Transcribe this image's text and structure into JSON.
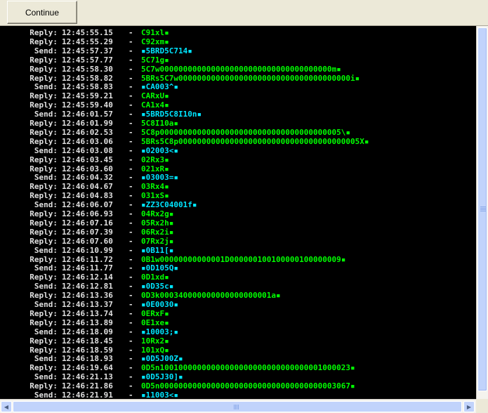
{
  "toolbar": {
    "continue_label": "Continue"
  },
  "colors": {
    "send": "#00e5ff",
    "reply": "#00ff00",
    "text": "#e0e0e0",
    "console_bg": "#000000"
  },
  "log": [
    {
      "dir": "Reply:",
      "time": "12:45:55.15",
      "payload": "C91xl▪"
    },
    {
      "dir": "Reply:",
      "time": "12:45:55.29",
      "payload": "C92xm▪"
    },
    {
      "dir": "Send:",
      "time": "12:45:57.37",
      "payload": "▪5BRD5C714▪"
    },
    {
      "dir": "Reply:",
      "time": "12:45:57.77",
      "payload": "5C71g▪"
    },
    {
      "dir": "Reply:",
      "time": "12:45:58.30",
      "payload": "5C7w0000000000000000000000000000000000000m▪"
    },
    {
      "dir": "Reply:",
      "time": "12:45:58.82",
      "payload": "5BRs5C7w0000000000000000000000000000000000000i▪"
    },
    {
      "dir": "Send:",
      "time": "12:45:58.83",
      "payload": "▪CA003^▪"
    },
    {
      "dir": "Reply:",
      "time": "12:45:59.21",
      "payload": "CARxU▪"
    },
    {
      "dir": "Reply:",
      "time": "12:45:59.40",
      "payload": "CA1x4▪"
    },
    {
      "dir": "Send:",
      "time": "12:46:01.57",
      "payload": "▪5BRD5C8I10n▪"
    },
    {
      "dir": "Reply:",
      "time": "12:46:01.99",
      "payload": "5C8I10a▪"
    },
    {
      "dir": "Reply:",
      "time": "12:46:02.53",
      "payload": "5C8p000000000000000000000000000000000000005\\▪"
    },
    {
      "dir": "Reply:",
      "time": "12:46:03.06",
      "payload": "5BRs5C8p000000000000000000000000000000000000005X▪"
    },
    {
      "dir": "Send:",
      "time": "12:46:03.08",
      "payload": "▪02003<▪"
    },
    {
      "dir": "Reply:",
      "time": "12:46:03.45",
      "payload": "02Rx3▪"
    },
    {
      "dir": "Reply:",
      "time": "12:46:03.60",
      "payload": "021xR▪"
    },
    {
      "dir": "Send:",
      "time": "12:46:04.32",
      "payload": "▪03003=▪"
    },
    {
      "dir": "Reply:",
      "time": "12:46:04.67",
      "payload": "03Rx4▪"
    },
    {
      "dir": "Reply:",
      "time": "12:46:04.83",
      "payload": "031xS▪"
    },
    {
      "dir": "Send:",
      "time": "12:46:06.07",
      "payload": "▪ZZ3C04001f▪"
    },
    {
      "dir": "Reply:",
      "time": "12:46:06.93",
      "payload": "04Rx2g▪"
    },
    {
      "dir": "Reply:",
      "time": "12:46:07.16",
      "payload": "05Rx2h▪"
    },
    {
      "dir": "Reply:",
      "time": "12:46:07.39",
      "payload": "06Rx2i▪"
    },
    {
      "dir": "Reply:",
      "time": "12:46:07.60",
      "payload": "07Rx2j▪"
    },
    {
      "dir": "Send:",
      "time": "12:46:10.99",
      "payload": "▪0B11[▪"
    },
    {
      "dir": "Reply:",
      "time": "12:46:11.72",
      "payload": "0B1w00000000000001D000000100100000100000009▪"
    },
    {
      "dir": "Send:",
      "time": "12:46:11.77",
      "payload": "▪0D105Q▪"
    },
    {
      "dir": "Reply:",
      "time": "12:46:12.14",
      "payload": "0D1xd▪"
    },
    {
      "dir": "Send:",
      "time": "12:46:12.81",
      "payload": "▪0D35c▪"
    },
    {
      "dir": "Reply:",
      "time": "12:46:13.36",
      "payload": "0D3k000340000000000000000001a▪"
    },
    {
      "dir": "Send:",
      "time": "12:46:13.37",
      "payload": "▪0E0030▪"
    },
    {
      "dir": "Reply:",
      "time": "12:46:13.74",
      "payload": "0ERxF▪"
    },
    {
      "dir": "Reply:",
      "time": "12:46:13.89",
      "payload": "0E1xe▪"
    },
    {
      "dir": "Send:",
      "time": "12:46:18.09",
      "payload": "▪10003;▪"
    },
    {
      "dir": "Reply:",
      "time": "12:46:18.45",
      "payload": "10Rx2▪"
    },
    {
      "dir": "Reply:",
      "time": "12:46:18.59",
      "payload": "101xQ▪"
    },
    {
      "dir": "Send:",
      "time": "12:46:18.93",
      "payload": "▪0D5J00Z▪"
    },
    {
      "dir": "Reply:",
      "time": "12:46:19.64",
      "payload": "0D5n10010000000000000000000000000000001000023▪"
    },
    {
      "dir": "Send:",
      "time": "12:46:21.13",
      "payload": "▪0D5J30]▪"
    },
    {
      "dir": "Reply:",
      "time": "12:46:21.86",
      "payload": "0D5n00000000000000000000000000000000000003067▪"
    },
    {
      "dir": "Send:",
      "time": "12:46:21.91",
      "payload": "▪11003<▪"
    }
  ]
}
